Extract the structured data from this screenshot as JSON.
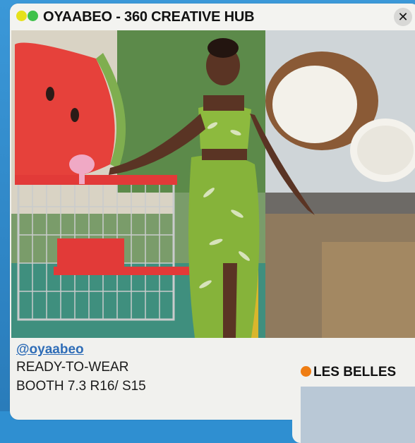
{
  "main_window": {
    "title": "OYAABEO - 360 CREATIVE HUB",
    "close_label": "✕",
    "dots": [
      "#e6e11a",
      "#3fc14a"
    ],
    "photo_icon": "fashion-photo",
    "handle": "@oyaabeo",
    "category": "READY-TO-WEAR",
    "booth": "BOOTH 7.3 R16/ S15"
  },
  "second_window": {
    "title": "LES BELLES",
    "dot_color": "#ef7d12"
  },
  "colors": {
    "background": "#2f8fd1",
    "link": "#2f6db7"
  }
}
